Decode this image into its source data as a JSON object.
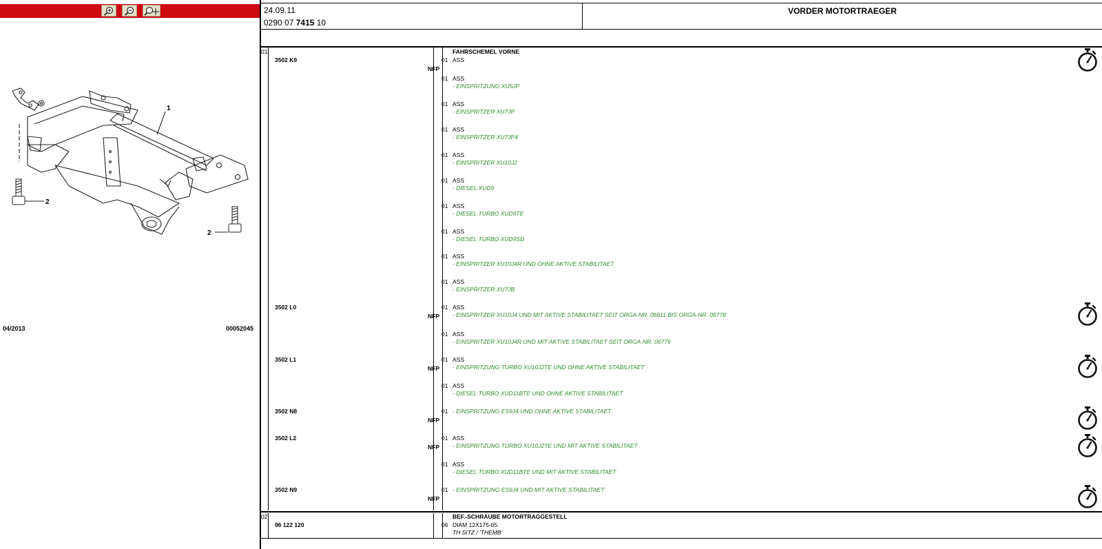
{
  "toolbar": {
    "zoom_in": "zoom-in-icon",
    "zoom_out": "zoom-out-icon",
    "zoom_fit": "zoom-fit-icon"
  },
  "drawing": {
    "callouts": [
      "1",
      "2",
      "2"
    ],
    "date": "04/2013",
    "number": "00052045"
  },
  "header": {
    "date": "24.09.11",
    "ref_prefix": "0290 07 ",
    "ref_bold": "7415",
    "ref_suffix": " 10",
    "title": "VORDER MOTORTRAEGER"
  },
  "groups": [
    {
      "pos": "01",
      "name": "FAHRSCHEMEL VORNE"
    },
    {
      "pos": "02",
      "name": "BEF.-SCHRAUBE MOTORTRAGGESTELL"
    }
  ],
  "parts": [
    {
      "no": "3502 K9",
      "nfp": "NFP"
    },
    {
      "no": "3502 L0",
      "nfp": "NFP"
    },
    {
      "no": "3502 L1",
      "nfp": "NFP"
    },
    {
      "no": "3502 N8",
      "nfp": "NFP"
    },
    {
      "no": "3502 L2",
      "nfp": "NFP"
    },
    {
      "no": "3502 N9",
      "nfp": "NFP"
    },
    {
      "no": "96 122 120",
      "nfp": ""
    }
  ],
  "entries": [
    {
      "qty": "01",
      "ass": "ASS",
      "desc": ""
    },
    {
      "qty": "01",
      "ass": "ASS",
      "desc": "- EINSPRITZUNG XU5JP"
    },
    {
      "qty": "01",
      "ass": "ASS",
      "desc": "- EINSPRITZER XU7JP"
    },
    {
      "qty": "01",
      "ass": "ASS",
      "desc": "- EINSPRITZER XU7JP4"
    },
    {
      "qty": "01",
      "ass": "ASS",
      "desc": "- EINSPRITZER XU10J2"
    },
    {
      "qty": "01",
      "ass": "ASS",
      "desc": "- DIESEL XUD9"
    },
    {
      "qty": "01",
      "ass": "ASS",
      "desc": "- DIESEL TURBO XUD9TE"
    },
    {
      "qty": "01",
      "ass": "ASS",
      "desc": "- DIESEL TURBO XUD9SD"
    },
    {
      "qty": "01",
      "ass": "ASS",
      "desc": "- EINSPRITZER XU10J4R UND OHNE AKTIVE STABILITAET"
    },
    {
      "qty": "01",
      "ass": "ASS",
      "desc": "- EINSPRITZER XU7JB"
    },
    {
      "qty": "01",
      "ass": "ASS",
      "desc": "- EINSPRITZER XU10J4 UND MIT AKTIVE STABILITAET SEIT ORGA-NR. 06611 BIS ORGA-NR. 06778"
    },
    {
      "qty": "01",
      "ass": "ASS",
      "desc": "- EINSPRITZER XU10J4R UND MIT AKTIVE STABILITAET SEIT ORGA-NR. 06779"
    },
    {
      "qty": "01",
      "ass": "ASS",
      "desc": "- EINSPRITZUNG TURBO XU10J2TE UND OHNE AKTIVE STABILITAET"
    },
    {
      "qty": "01",
      "ass": "ASS",
      "desc": "- DIESEL TURBO XUD11BTE UND OHNE AKTIVE STABILITAET"
    },
    {
      "qty": "01",
      "ass": "",
      "desc": "- EINSPRITZUNG ES9J4 UND OHNE AKTIVE STABILITAET"
    },
    {
      "qty": "01",
      "ass": "ASS",
      "desc": "- EINSPRITZUNG TURBO XU10J2TE UND MIT AKTIVE STABILITAET"
    },
    {
      "qty": "01",
      "ass": "ASS",
      "desc": "- DIESEL TURBO XUD11BTE UND MIT AKTIVE STABILITAET"
    },
    {
      "qty": "01",
      "ass": "",
      "desc": "- EINSPRITZUNG ES9J4 UND MIT AKTIVE STABILITAET"
    }
  ],
  "screw": {
    "qty": "06",
    "spec": "DIAM 12X175-65",
    "note": "TH SITZ / 'THEMB'"
  }
}
